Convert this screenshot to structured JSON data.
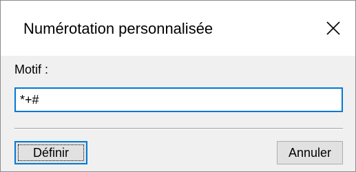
{
  "dialog": {
    "title": "Numérotation personnalisée",
    "close_icon": "close-icon",
    "motif_label": "Motif :",
    "motif_value": "*+#",
    "buttons": {
      "define_label": "Définir",
      "cancel_label": "Annuler"
    }
  },
  "colors": {
    "accent": "#0078d7",
    "dialog_background": "#f0f0f0",
    "titlebar_background": "#ffffff",
    "button_background": "#e1e1e1"
  }
}
